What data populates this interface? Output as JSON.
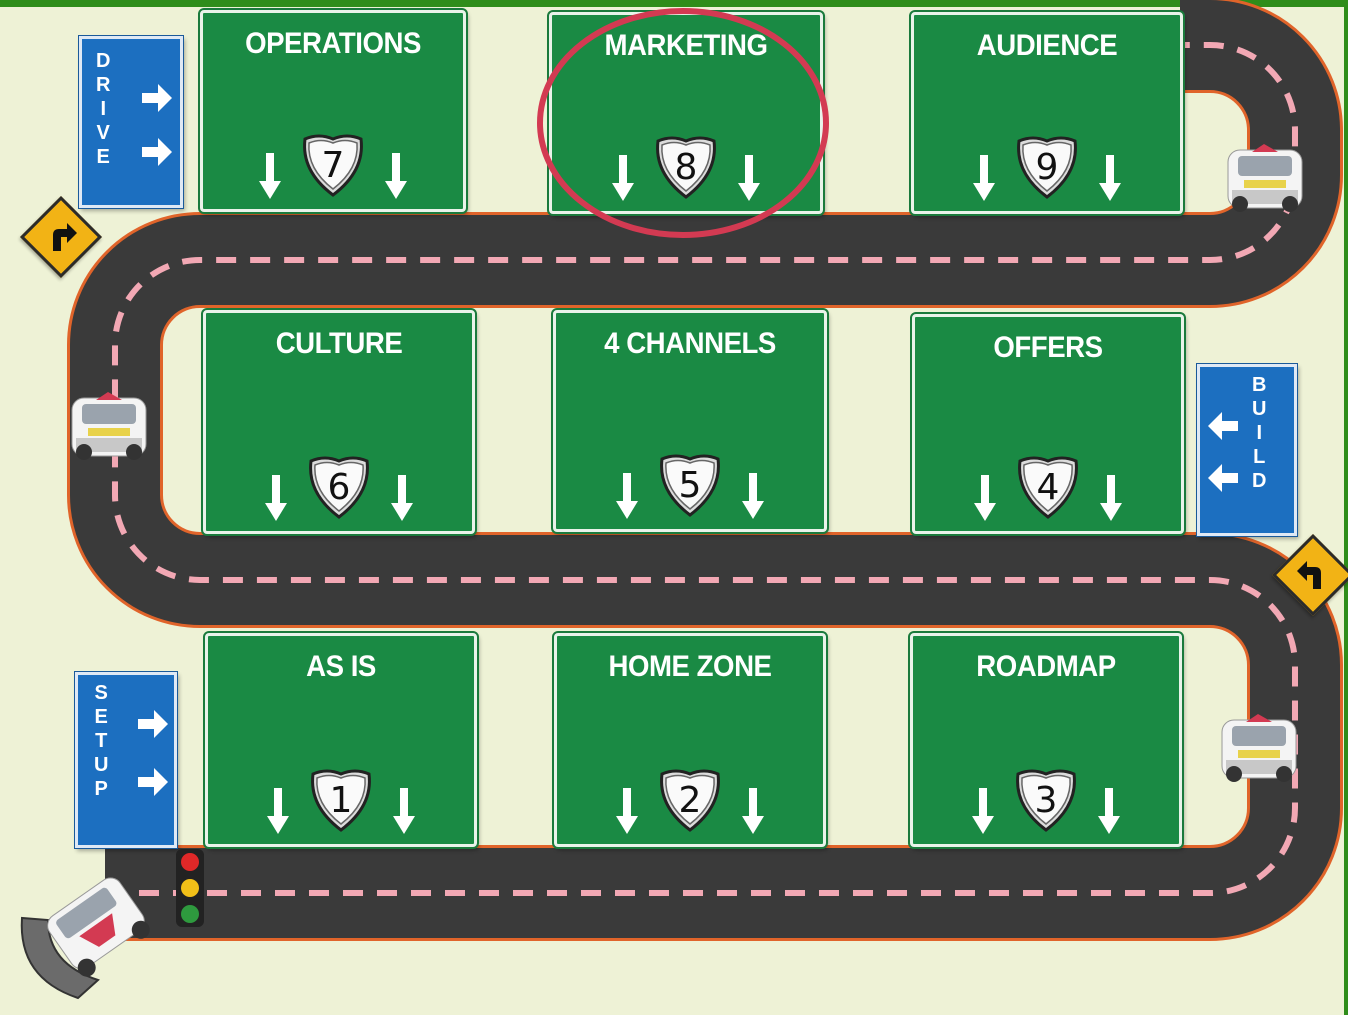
{
  "signs": [
    {
      "title": "OPERATIONS",
      "number": "7"
    },
    {
      "title": "MARKETING",
      "number": "8"
    },
    {
      "title": "AUDIENCE",
      "number": "9"
    },
    {
      "title": "CULTURE",
      "number": "6"
    },
    {
      "title": "4 CHANNELS",
      "number": "5"
    },
    {
      "title": "OFFERS",
      "number": "4"
    },
    {
      "title": "AS IS",
      "number": "1"
    },
    {
      "title": "HOME ZONE",
      "number": "2"
    },
    {
      "title": "ROADMAP",
      "number": "3"
    }
  ],
  "phase_signs": {
    "drive": [
      "D",
      "R",
      "I",
      "V",
      "E"
    ],
    "build": [
      "B",
      "U",
      "I",
      "L",
      "D"
    ],
    "setup": [
      "S",
      "E",
      "T",
      "U",
      "P"
    ]
  },
  "highlight": {
    "target": "MARKETING",
    "color": "#d33a52"
  },
  "colors": {
    "sign_green": "#1a8a44",
    "phase_blue": "#1c6fc0",
    "road": "#3a3a3a",
    "road_edge": "#e0642a",
    "lane_dash": "#f2a8b4",
    "background": "#eef2d6",
    "warning": "#f2b315"
  },
  "icons": [
    "arrow-down-icon",
    "interstate-shield-icon",
    "arrow-right-icon",
    "arrow-left-icon",
    "turn-right-warning-icon",
    "turn-left-warning-icon",
    "race-car-icon",
    "traffic-light-icon"
  ]
}
